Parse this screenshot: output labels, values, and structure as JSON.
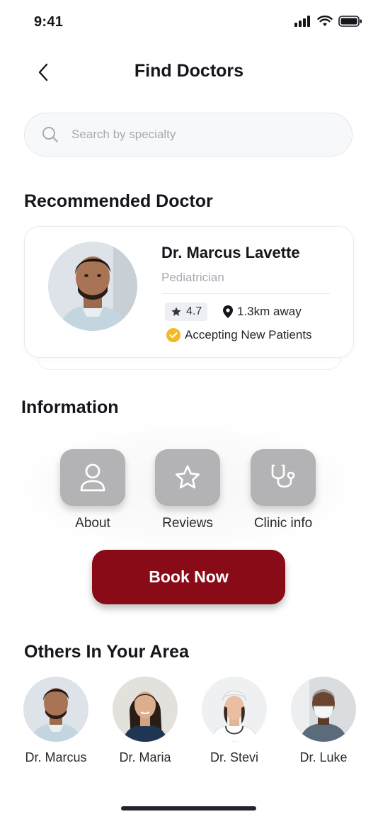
{
  "status_bar": {
    "time": "9:41"
  },
  "header": {
    "title": "Find Doctors"
  },
  "search": {
    "placeholder": "Search by specialty"
  },
  "recommended": {
    "section_title": "Recommended Doctor",
    "name": "Dr. Marcus Lavette",
    "specialty": "Pediatrician",
    "rating": "4.7",
    "distance": "1.3km away",
    "status": "Accepting New Patients"
  },
  "information": {
    "section_title": "Information",
    "items": [
      {
        "label": "About",
        "icon": "user-icon"
      },
      {
        "label": "Reviews",
        "icon": "star-icon"
      },
      {
        "label": "Clinic info",
        "icon": "stethoscope-icon"
      }
    ]
  },
  "book_button": {
    "label": "Book Now"
  },
  "others": {
    "section_title": "Others In Your Area",
    "doctors": [
      {
        "name": "Dr. Marcus"
      },
      {
        "name": "Dr. Maria"
      },
      {
        "name": "Dr. Stevi"
      },
      {
        "name": "Dr. Luke"
      }
    ]
  },
  "colors": {
    "accent": "#8a0b18",
    "verified": "#f2b928",
    "icon_button": "#b3b3b5"
  }
}
